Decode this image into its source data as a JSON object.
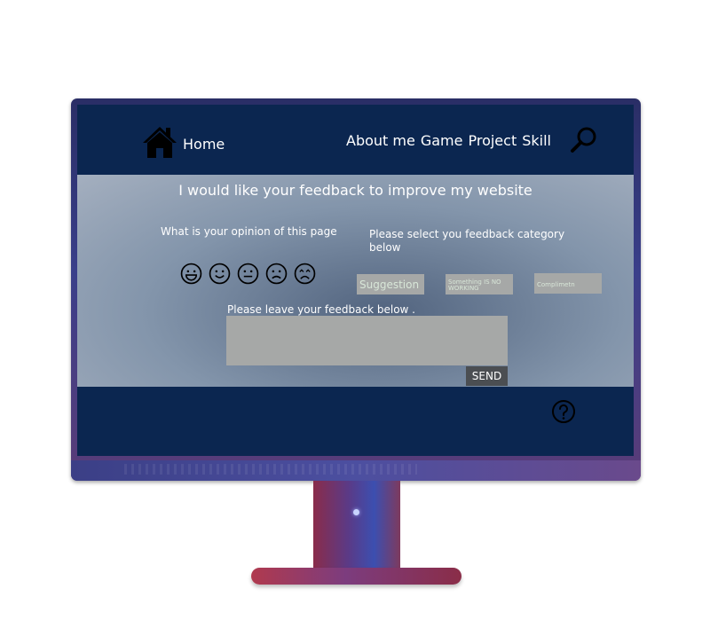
{
  "nav": {
    "home_label": "Home",
    "links": [
      "About me",
      "Game",
      "Project",
      "Skill"
    ],
    "home_icon": "home-icon",
    "search_icon": "search-icon"
  },
  "main": {
    "headline": "I would like your feedback to improve my website",
    "opinion_label": "What is your opinion of this page",
    "category_label": "Please select you feedback category below",
    "emojis": [
      "grinning-face-icon",
      "smiling-face-icon",
      "neutral-face-icon",
      "sad-face-icon",
      "frowning-face-icon"
    ],
    "categories": [
      "Suggestion",
      "Something IS NO WORKING",
      "Complimetn"
    ],
    "feedback_label": "Please leave your feedback below .",
    "feedback_value": "",
    "send_label": "SEND"
  },
  "footer": {
    "help_icon": "help-icon"
  },
  "colors": {
    "screen_bg": "#0b2650",
    "button_gray": "#a6a8a7",
    "send_bg": "#4b4e52",
    "button_text": "#d8e6d8"
  }
}
